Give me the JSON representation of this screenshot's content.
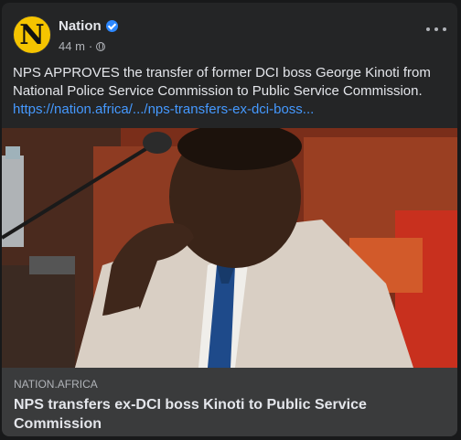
{
  "post": {
    "page_name": "Nation",
    "avatar_letter": "N",
    "time": "44 m",
    "separator": "·",
    "body_text": "NPS APPROVES the transfer of former DCI boss George Kinoti from National Police Service Commission to Public Service Commission.",
    "link_text": "https://nation.africa/.../nps-transfers-ex-dci-boss...",
    "icons": [
      "verified-badge-icon",
      "globe-icon",
      "more-options-icon"
    ]
  },
  "link_preview": {
    "domain": "NATION.AFRICA",
    "headline": "NPS transfers ex-DCI boss Kinoti to Public Service Commission"
  },
  "colors": {
    "background": "#18191a",
    "card": "#242526",
    "preview_footer": "#3a3b3c",
    "primary_text": "#e4e6eb",
    "secondary_text": "#b0b3b8",
    "link": "#4599ff",
    "verified": "#2d88ff",
    "avatar_bg": "#f5c400"
  }
}
